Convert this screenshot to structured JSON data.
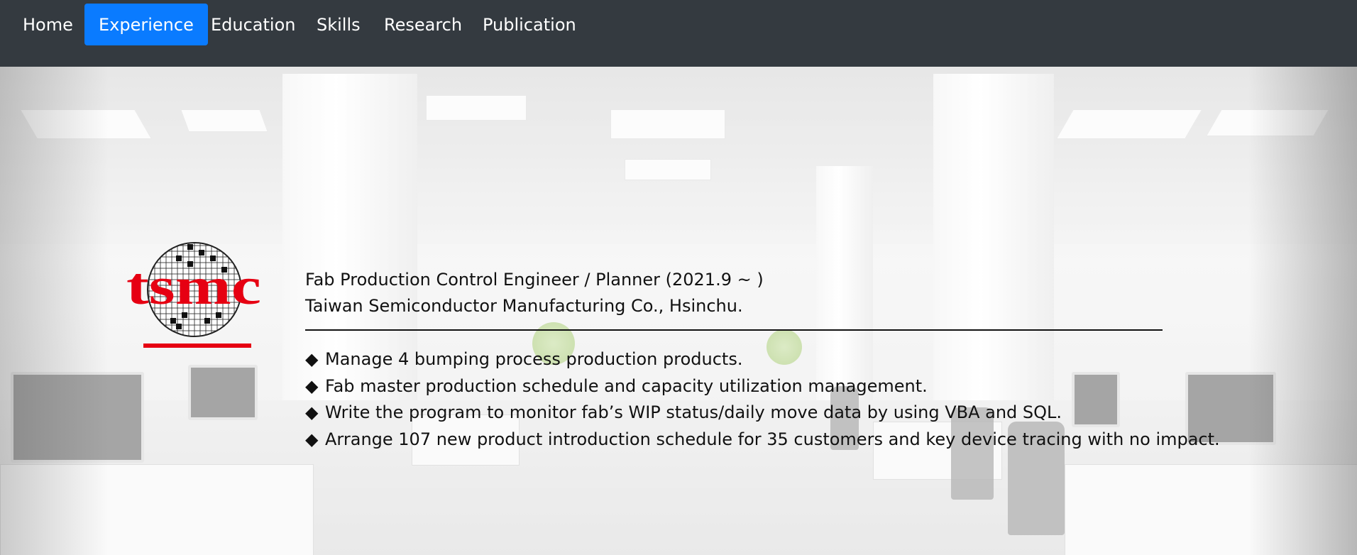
{
  "nav": {
    "items": [
      {
        "label": "Home",
        "active": false
      },
      {
        "label": "Experience",
        "active": true
      },
      {
        "label": "Education",
        "active": false
      },
      {
        "label": "Skills",
        "active": false
      },
      {
        "label": "Research",
        "active": false
      },
      {
        "label": "Publication",
        "active": false
      }
    ]
  },
  "experience": {
    "logo_text": "tsmc",
    "title": "Fab Production Control Engineer / Planner (2021.9 ~ )",
    "company": "Taiwan Semiconductor Manufacturing Co., Hsinchu.",
    "bullet_icon": "◆",
    "bullets": [
      "Manage 4 bumping process production products.",
      "Fab master production schedule and capacity utilization management.",
      "Write the program to monitor fab’s WIP status/daily move data by using VBA and SQL.",
      "Arrange 107 new product introduction schedule for 35 customers and key device tracing with no impact."
    ]
  },
  "colors": {
    "navbar_bg": "#343a40",
    "active_bg": "#0a7bff",
    "logo_red": "#e60012"
  }
}
